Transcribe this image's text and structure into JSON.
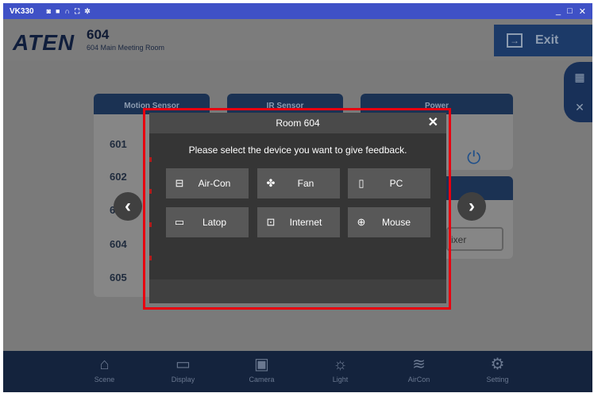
{
  "window": {
    "title": "VK330",
    "toolbar_icons": [
      "camera-icon",
      "video-icon",
      "headset-icon",
      "fullscreen-icon",
      "settings-icon"
    ],
    "controls": {
      "minimize": "_",
      "maximize": "□",
      "close": "✕"
    }
  },
  "header": {
    "logo": "ATEN",
    "room_number": "604",
    "room_name": "604 Main Meeting Room",
    "exit_label": "Exit"
  },
  "side_tools": [
    "schedule-icon",
    "tools-icon"
  ],
  "cards": {
    "motion_sensor": "Motion Sensor",
    "ir_sensor": "IR Sensor",
    "power": "Power",
    "mixer": "ixer"
  },
  "room_list": [
    "601",
    "602",
    "603",
    "604",
    "605"
  ],
  "modal": {
    "title": "Room 604",
    "close": "✕",
    "prompt": "Please select the device you want to give feedback.",
    "devices": [
      {
        "label": "Air-Con",
        "icon": "aircon-icon"
      },
      {
        "label": "Fan",
        "icon": "fan-icon"
      },
      {
        "label": "PC",
        "icon": "pc-icon"
      },
      {
        "label": "Latop",
        "icon": "laptop-icon"
      },
      {
        "label": "Internet",
        "icon": "internet-icon"
      },
      {
        "label": "Mouse",
        "icon": "mouse-icon"
      }
    ]
  },
  "nav": {
    "arrow_left": "‹",
    "arrow_right": "›"
  },
  "bottom_nav": [
    {
      "label": "Scene",
      "icon": "home-icon"
    },
    {
      "label": "Display",
      "icon": "display-icon"
    },
    {
      "label": "Camera",
      "icon": "camera-icon"
    },
    {
      "label": "Light",
      "icon": "bulb-icon"
    },
    {
      "label": "AirCon",
      "icon": "aircon-wave-icon"
    },
    {
      "label": "Setting",
      "icon": "gear-icon"
    }
  ],
  "colors": {
    "titlebar": "#3f51c6",
    "navy": "#1b3253",
    "highlight": "#e8000f"
  }
}
